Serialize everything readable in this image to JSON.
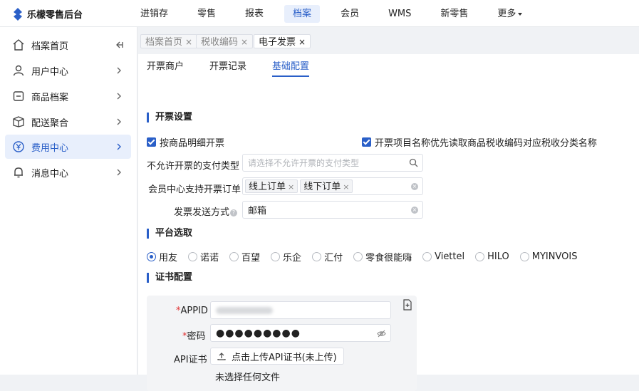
{
  "app": {
    "title": "乐檬零售后台",
    "brand_color": "#2a5fc8"
  },
  "topnav": [
    {
      "label": "进销存"
    },
    {
      "label": "零售"
    },
    {
      "label": "报表"
    },
    {
      "label": "档案",
      "active": true
    },
    {
      "label": "会员"
    },
    {
      "label": "WMS"
    },
    {
      "label": "新零售"
    },
    {
      "label": "更多"
    }
  ],
  "sidebar": {
    "items": [
      {
        "label": "档案首页",
        "icon": "home-icon"
      },
      {
        "label": "用户中心",
        "icon": "user-icon"
      },
      {
        "label": "商品档案",
        "icon": "box-icon"
      },
      {
        "label": "配送聚合",
        "icon": "delivery-icon"
      },
      {
        "label": "费用中心",
        "icon": "yen-icon",
        "active": true
      },
      {
        "label": "消息中心",
        "icon": "bell-icon"
      }
    ]
  },
  "tabs": [
    {
      "label": "档案首页"
    },
    {
      "label": "税收编码"
    },
    {
      "label": "电子发票",
      "active": true
    }
  ],
  "subtabs": [
    {
      "label": "开票商户"
    },
    {
      "label": "开票记录"
    },
    {
      "label": "基础配置",
      "active": true
    }
  ],
  "invoice_settings": {
    "title": "开票设置",
    "checkbox_detail": "按商品明细开票",
    "checkbox_tax_code": "开票项目名称优先读取商品税收编码对应税收分类名称",
    "disallow_payment_label": "不允许开票的支付类型",
    "disallow_payment_placeholder": "请选择不允许开票的支付类型",
    "member_orders_label": "会员中心支持开票订单",
    "member_orders": [
      "线上订单",
      "线下订单"
    ],
    "send_method_label": "发票发送方式",
    "send_method_value": "邮箱"
  },
  "platform": {
    "title": "平台选取",
    "options": [
      "用友",
      "诺诺",
      "百望",
      "乐企",
      "汇付",
      "零食很能嗨",
      "Viettel",
      "HILO",
      "MYINVOIS"
    ],
    "selected": "用友"
  },
  "certificate": {
    "title": "证书配置",
    "appid_label": "APPID",
    "password_label": "密码",
    "password_value": "●●●●●●●●●",
    "api_cert_label": "API证书",
    "upload_label": "点击上传API证书(未上传)",
    "no_file_text": "未选择任何文件"
  }
}
